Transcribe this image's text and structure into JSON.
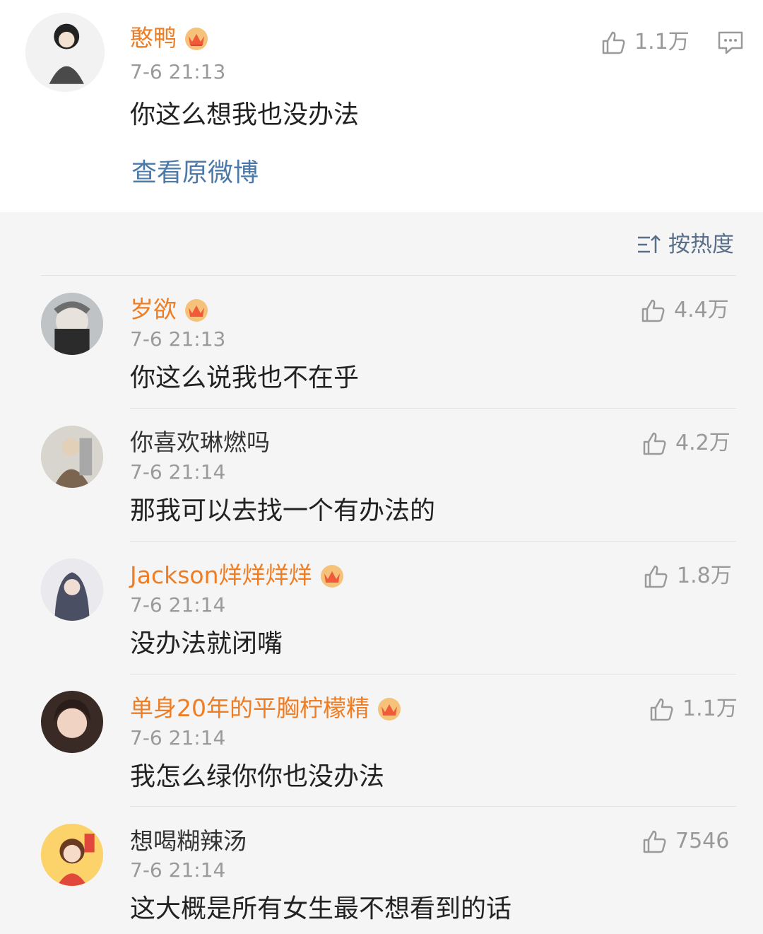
{
  "post": {
    "username": "憨鸭",
    "time": "7-6 21:13",
    "content": "你这么想我也没办法",
    "likes": "1.1万",
    "view_original": "查看原微博"
  },
  "sort": {
    "label": "按热度"
  },
  "comments": [
    {
      "username": "岁欲",
      "vip": true,
      "time": "7-6 21:13",
      "content": "你这么说我也不在乎",
      "likes": "4.4万"
    },
    {
      "username": "你喜欢琳燃吗",
      "vip": false,
      "time": "7-6 21:14",
      "content": "那我可以去找一个有办法的",
      "likes": "4.2万"
    },
    {
      "username": "Jackson烊烊烊烊",
      "vip": true,
      "time": "7-6 21:14",
      "content": "没办法就闭嘴",
      "likes": "1.8万"
    },
    {
      "username": "单身20年的平胸柠檬精",
      "vip": true,
      "time": "7-6 21:14",
      "content": "我怎么绿你你也没办法",
      "likes": "1.1万"
    },
    {
      "username": "想喝糊辣汤",
      "vip": false,
      "time": "7-6 21:14",
      "content": "这大概是所有女生最不想看到的话",
      "likes": "7546"
    }
  ],
  "colors": {
    "vip_name": "#ef7d23",
    "link": "#4c7aa8",
    "sort": "#5a6f89",
    "meta": "#9a9a9a"
  },
  "icons": [
    "thumbs-up-icon",
    "comment-icon",
    "sort-icon",
    "crown-icon"
  ]
}
